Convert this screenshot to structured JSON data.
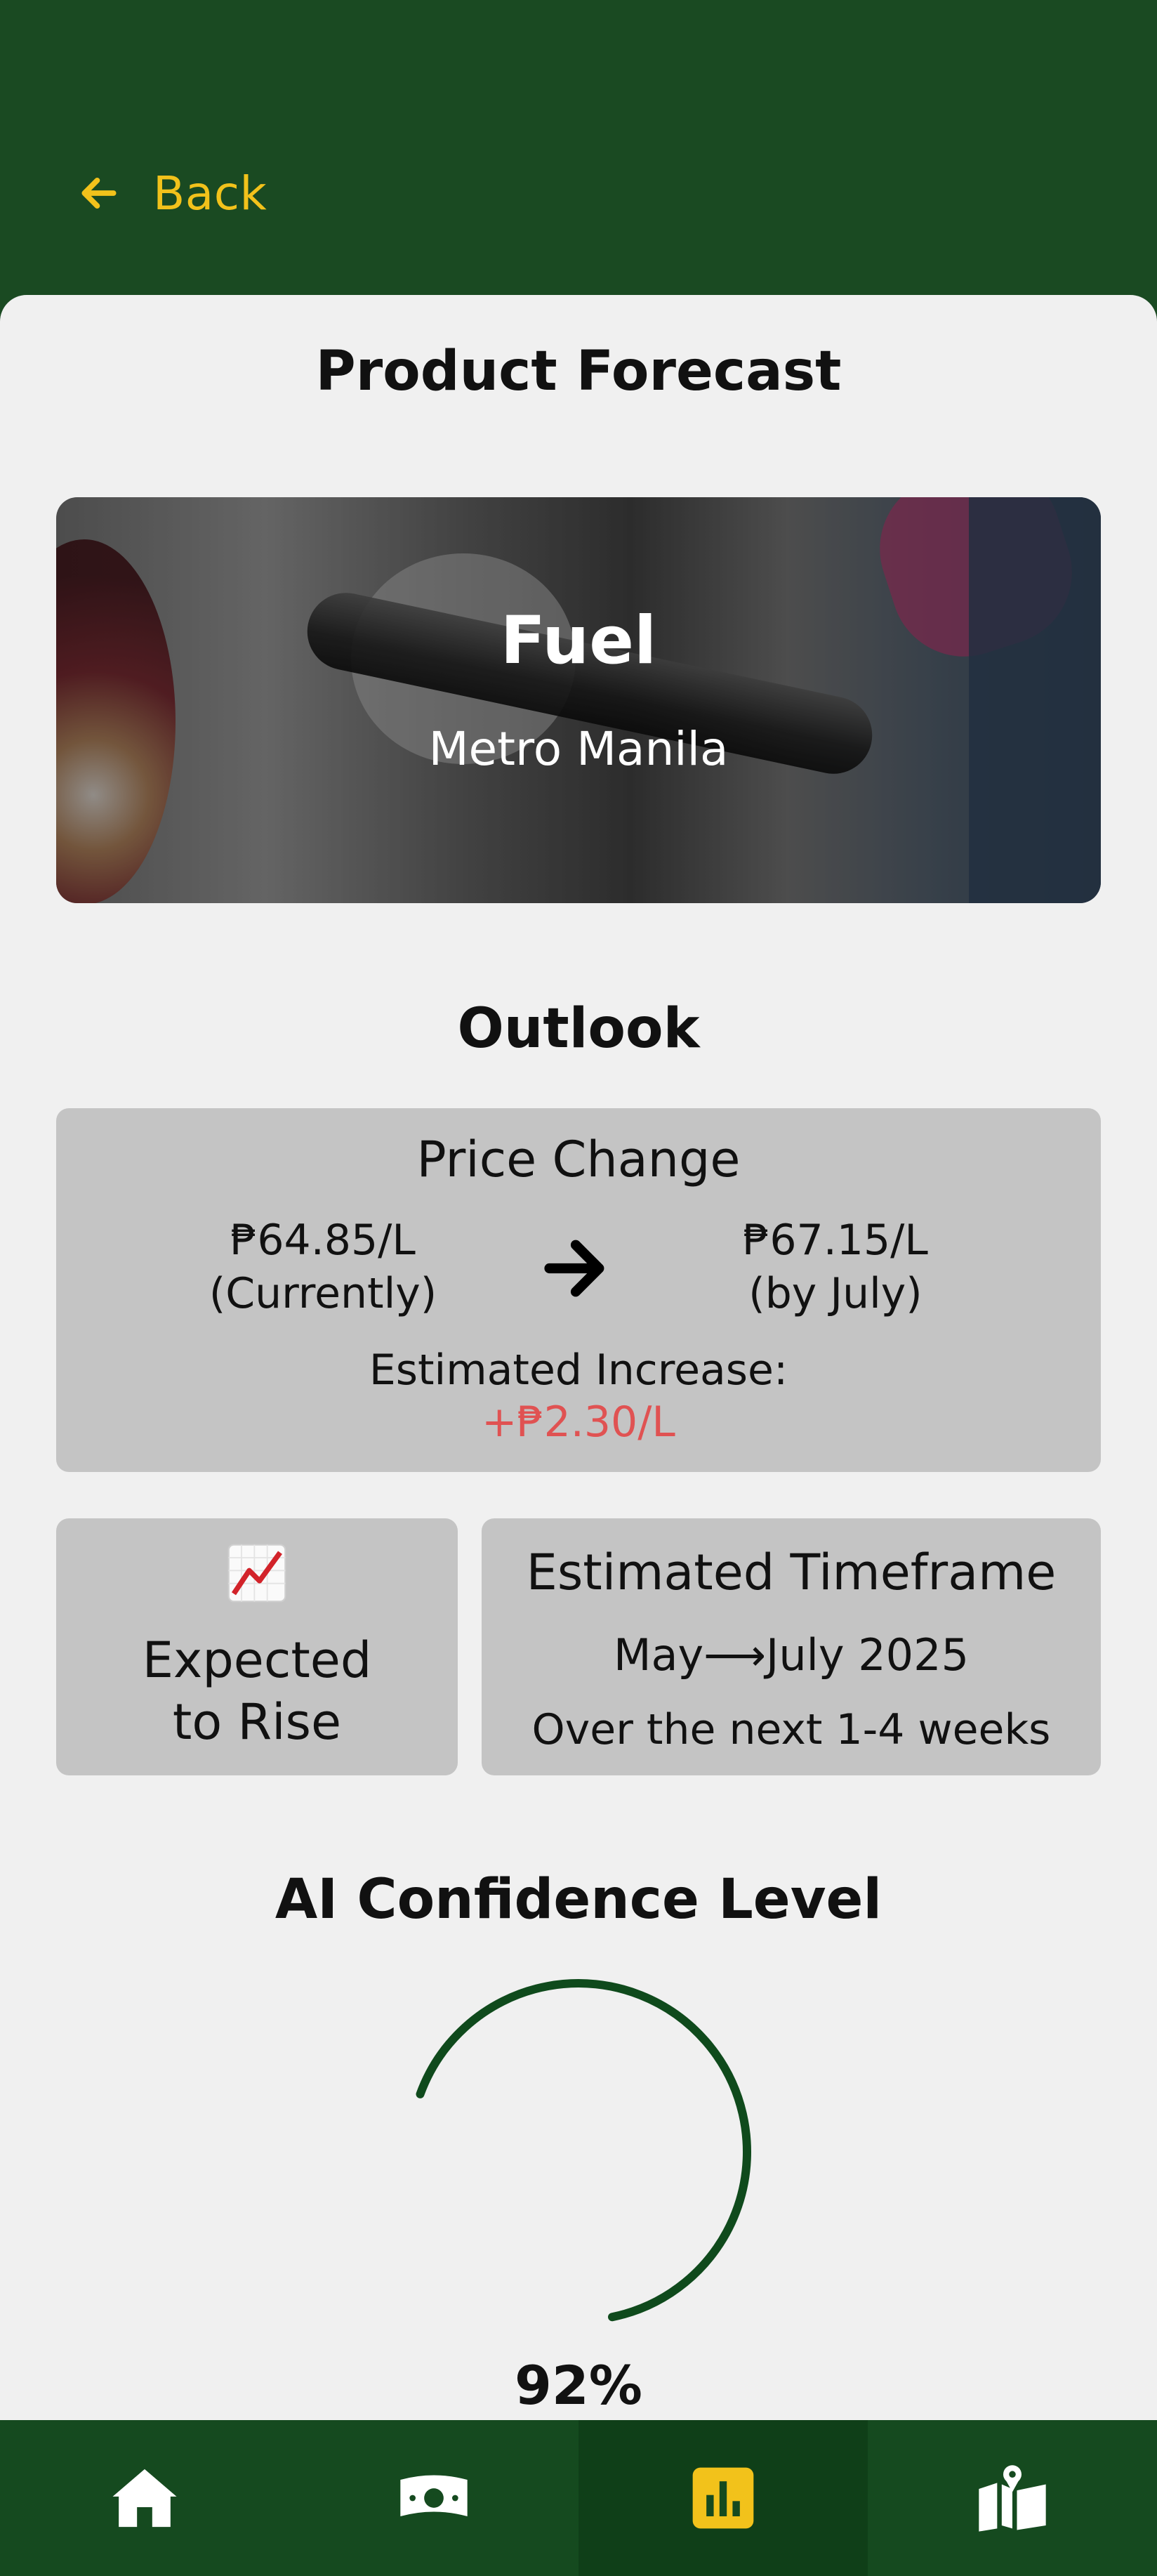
{
  "header": {
    "back_label": "Back"
  },
  "page": {
    "title": "Product Forecast"
  },
  "product": {
    "name": "Fuel",
    "region": "Metro Manila"
  },
  "outlook": {
    "title": "Outlook",
    "price_change": {
      "title": "Price Change",
      "current_price": "₱64.85/L",
      "current_note": "(Currently)",
      "future_price": "₱67.15/L",
      "future_note": "(by July)",
      "increase_label": "Estimated Increase:",
      "increase_value": "+₱2.30/L",
      "increase_color": "#e05252"
    },
    "trend": {
      "line1": "Expected",
      "line2": "to Rise",
      "icon": "chart-increasing-icon"
    },
    "timeframe": {
      "title": "Estimated Timeframe",
      "range": "May⟶July 2025",
      "description": "Over the next 1-4 weeks"
    }
  },
  "confidence": {
    "title": "AI Confidence Level",
    "value_text": "92%",
    "value": 0.92,
    "color": "#0f4a1c"
  },
  "nav": {
    "items": [
      {
        "name": "home",
        "icon": "home-icon",
        "active": false
      },
      {
        "name": "prices",
        "icon": "money-icon",
        "active": false
      },
      {
        "name": "forecast",
        "icon": "bar-chart-icon",
        "active": true
      },
      {
        "name": "map",
        "icon": "map-icon",
        "active": false
      }
    ]
  },
  "colors": {
    "brand_green": "#1a4a22",
    "accent_yellow": "#f2c21b",
    "card_gray": "#c4c4c4"
  }
}
